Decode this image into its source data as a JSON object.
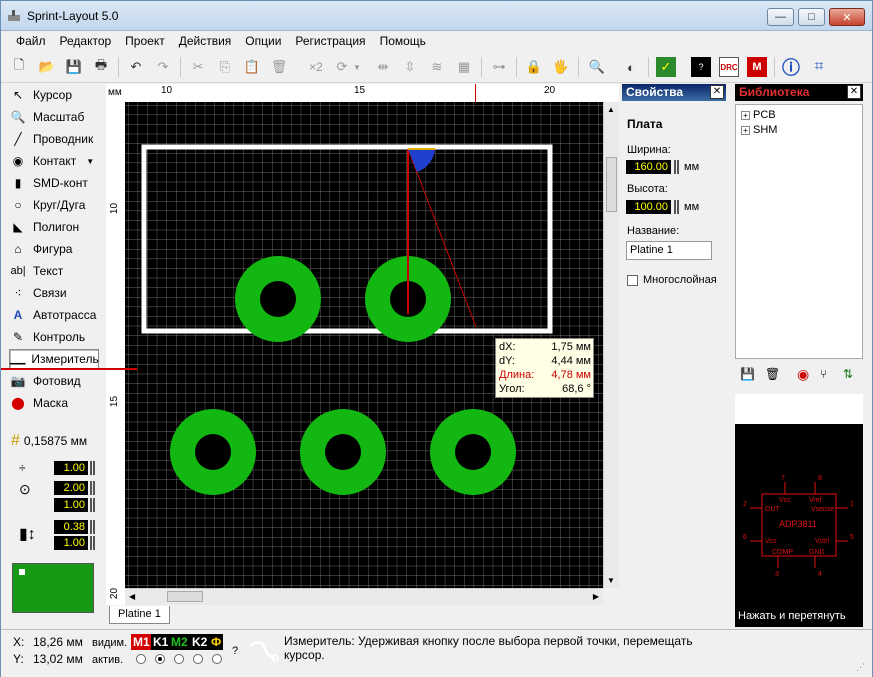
{
  "window": {
    "title": "Sprint-Layout 5.0",
    "min": "—",
    "max": "□",
    "close": "✕"
  },
  "menu": [
    "Файл",
    "Редактор",
    "Проект",
    "Действия",
    "Опции",
    "Регистрация",
    "Помощь"
  ],
  "toolbar": {
    "zoom_label": "×2"
  },
  "tools": [
    {
      "label": "Курсор",
      "icon": "cursor-icon"
    },
    {
      "label": "Масштаб",
      "icon": "zoom-icon"
    },
    {
      "label": "Проводник",
      "icon": "track-icon"
    },
    {
      "label": "Контакт",
      "icon": "pad-icon"
    },
    {
      "label": "SMD-конт",
      "icon": "smd-icon"
    },
    {
      "label": "Круг/Дуга",
      "icon": "circle-icon"
    },
    {
      "label": "Полигон",
      "icon": "polygon-icon"
    },
    {
      "label": "Фигура",
      "icon": "shape-icon"
    },
    {
      "label": "Текст",
      "icon": "text-icon"
    },
    {
      "label": "Связи",
      "icon": "connections-icon"
    },
    {
      "label": "Автотрасса",
      "icon": "autoroute-icon"
    },
    {
      "label": "Контроль",
      "icon": "check-icon"
    },
    {
      "label": "Измеритель",
      "icon": "ruler-icon"
    },
    {
      "label": "Фотовид",
      "icon": "camera-icon"
    },
    {
      "label": "Маска",
      "icon": "mask-icon"
    }
  ],
  "grid": {
    "value": "0,15875 мм"
  },
  "tool_values": {
    "track_width": "1.00",
    "pad_outer": "2.00",
    "pad_inner": "1.00",
    "smd_x": "0.38",
    "smd_y": "1.00"
  },
  "ruler": {
    "unit": "мм",
    "top_ticks": [
      "10",
      "15",
      "20"
    ],
    "left_ticks": [
      "10",
      "15",
      "20"
    ]
  },
  "measure": {
    "dx_label": "dX:",
    "dx": "1,75 мм",
    "dy_label": "dY:",
    "dy": "4,44 мм",
    "len_label": "Длина:",
    "len": "4,78 мм",
    "angle_label": "Угол:",
    "angle": "68,6 °"
  },
  "tabs": [
    "Platine 1"
  ],
  "properties": {
    "header": "Свойства",
    "section": "Плата",
    "width_label": "Ширина:",
    "width": "160.00",
    "width_unit": "мм",
    "height_label": "Высота:",
    "height": "100.00",
    "height_unit": "мм",
    "name_label": "Название:",
    "name": "Platine 1",
    "multilayer_label": "Многослойная"
  },
  "library": {
    "header": "Библиотека",
    "items": [
      "PCB",
      "SHM"
    ],
    "chip_name": "ADP3811",
    "pins": {
      "p1": "Vcc",
      "p2": "Vref",
      "p3": "OUT",
      "p4": "Vsense",
      "p5": "Vctrl",
      "p6": "Vcs",
      "p7": "COMP",
      "p8": "GND"
    },
    "pin_numbers": [
      "7",
      "8",
      "1",
      "2",
      "5",
      "6",
      "3",
      "4"
    ],
    "drag_hint": "Нажать и перетянуть"
  },
  "status": {
    "x_label": "X:",
    "x": "18,26 мм",
    "y_label": "Y:",
    "y": "13,02 мм",
    "visible_label": "видим.",
    "active_label": "актив.",
    "layers": [
      "M1",
      "K1",
      "M2",
      "K2",
      "Ф"
    ],
    "help": "?",
    "message": "Измеритель: Удерживая кнопку после выбора первой точки, перемещать курсор."
  },
  "colors": {
    "pad": "#12b712",
    "grid": "#6e6e6e",
    "outline": "#ffffff",
    "measure": "#cc0000",
    "layer_m1": "#d40000",
    "layer_m2": "#00a000"
  }
}
